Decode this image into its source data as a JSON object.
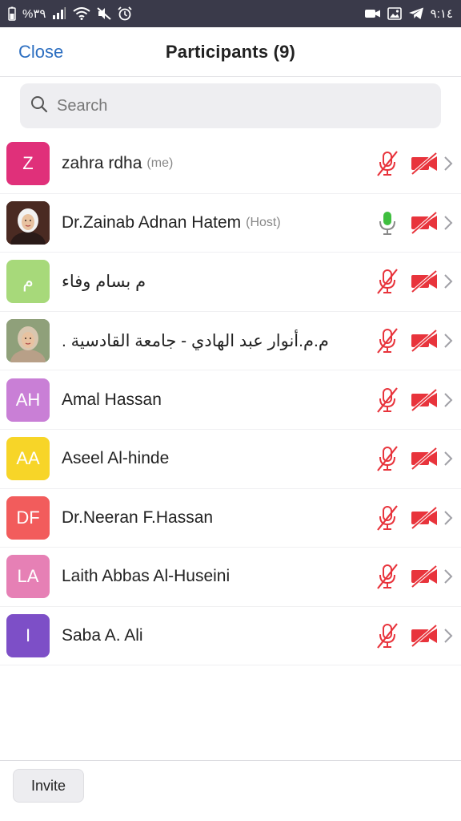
{
  "status_bar": {
    "time": "٩:١٤",
    "battery": "%٣٩",
    "left_icons": [
      "battery-icon",
      "signal-icon",
      "wifi-icon",
      "mute-icon",
      "alarm-icon"
    ],
    "right_icons": [
      "video-notification-icon",
      "gallery-icon",
      "telegram-icon"
    ]
  },
  "header": {
    "close_label": "Close",
    "title": "Participants (9)"
  },
  "search": {
    "placeholder": "Search"
  },
  "colors": {
    "accent": "#2d6fc1",
    "muted_red": "#e8343c",
    "mic_green": "#3fbf3f"
  },
  "participants": [
    {
      "initials": "Z",
      "name": "zahra rdha",
      "role": "(me)",
      "avatar_color": "#e0307a",
      "avatar_type": "initials",
      "mic": "muted",
      "video": "off"
    },
    {
      "initials": "",
      "name": "Dr.Zainab Adnan Hatem",
      "role": "(Host)",
      "avatar_color": "#5a3a2a",
      "avatar_type": "photo",
      "mic": "on",
      "video": "off"
    },
    {
      "initials": "م",
      "name": "م بسام وفاء",
      "role": "",
      "avatar_color": "#a7d97a",
      "avatar_type": "initials",
      "mic": "muted",
      "video": "off"
    },
    {
      "initials": "",
      "name": "م.م.أنوار عبد الهادي - جامعة القادسية .",
      "role": "",
      "avatar_color": "#8a9a7a",
      "avatar_type": "photo",
      "mic": "muted",
      "video": "off"
    },
    {
      "initials": "AH",
      "name": "Amal Hassan",
      "role": "",
      "avatar_color": "#c97fd6",
      "avatar_type": "initials",
      "mic": "muted",
      "video": "off"
    },
    {
      "initials": "AA",
      "name": "Aseel Al-hinde",
      "role": "",
      "avatar_color": "#f7d528",
      "avatar_type": "initials",
      "mic": "muted",
      "video": "off"
    },
    {
      "initials": "DF",
      "name": "Dr.Neeran F.Hassan",
      "role": "",
      "avatar_color": "#f25c5c",
      "avatar_type": "initials",
      "mic": "muted",
      "video": "off"
    },
    {
      "initials": "LA",
      "name": "Laith Abbas Al-Huseini",
      "role": "",
      "avatar_color": "#e680b5",
      "avatar_type": "initials",
      "mic": "muted",
      "video": "off"
    },
    {
      "initials": "I",
      "name": "Saba A. Ali",
      "role": "",
      "avatar_color": "#7d4fc7",
      "avatar_type": "initials",
      "mic": "muted",
      "video": "off"
    }
  ],
  "footer": {
    "invite_label": "Invite"
  }
}
